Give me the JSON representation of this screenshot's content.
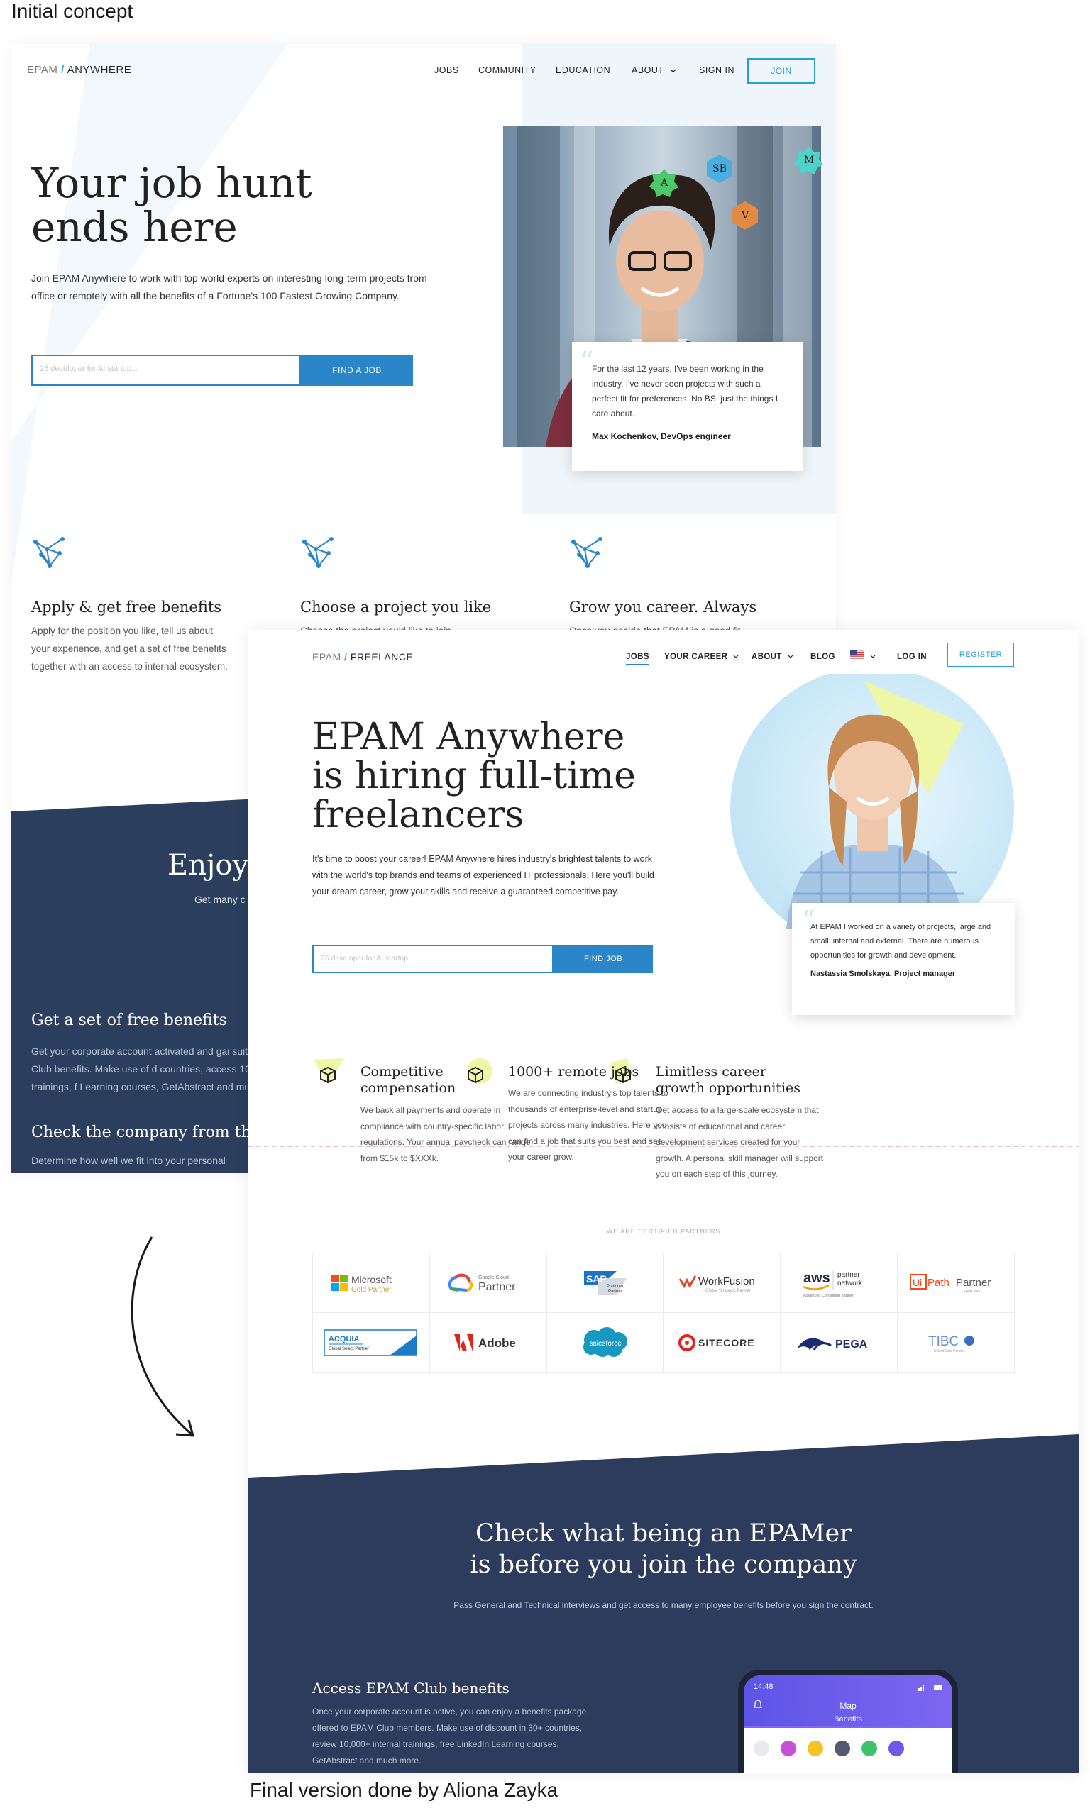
{
  "captions": {
    "top": "Initial concept",
    "bottom": "Final version done by Aliona Zayka"
  },
  "concept": {
    "logo": {
      "brand": "EPAM",
      "sep": "/",
      "product": "ANYWHERE"
    },
    "nav": [
      "JOBS",
      "COMMUNITY",
      "EDUCATION",
      "ABOUT",
      "SIGN IN"
    ],
    "join_label": "JOIN",
    "title_line1": "Your job hunt",
    "title_line2": "ends here",
    "lead": "Join EPAM Anywhere to work with top world experts on interesting long-term projects from office or remotely with all the  benefits of a Fortune's 100 Fastest Growing Company.",
    "search_placeholder": "25 developer for AI startup...",
    "find_label": "FIND A JOB",
    "badges": [
      "A",
      "SB",
      "V",
      "M"
    ],
    "quote_text": "For the last 12 years, I've been working in the industry, I've never seen projects with such a perfect fit for preferences. No BS, just the things I care about.",
    "quote_author": "Max Kochenkov, DevOps engineer",
    "features": [
      {
        "title": "Apply & get free benefits",
        "text": "Apply for the position you like, tell us about your experience, and get a set of free benefits together with an access to internal ecosystem."
      },
      {
        "title": "Choose a project you like",
        "text": "Choose the project you'd like to join -"
      },
      {
        "title": "Grow you career. Always",
        "text": "Once you decide that EPAM is a good fit"
      }
    ],
    "enjoy": "Enjoy",
    "get_many": "Get many c",
    "free_title": "Get a set of free benefits",
    "free_text": "Get your corporate account activated and gai suit of free EPAM Club benefits. Make use of d countries, access 10,000+ internal trainings, f Learning courses, GetAbstract and much mor",
    "check_title": "Check the company from the",
    "check_text": "Determine how well we fit into your personal"
  },
  "final": {
    "logo": {
      "brand": "EPAM",
      "sep": "/",
      "product": "FREELANCE"
    },
    "nav": [
      "JOBS",
      "YOUR CAREER",
      "ABOUT",
      "BLOG",
      "LOG IN"
    ],
    "register_label": "REGISTER",
    "title_line1": "EPAM Anywhere",
    "title_line2": "is hiring full-time",
    "title_line3": "freelancers",
    "lead": "It's time to boost your career! EPAM Anywhere hires industry's brightest talents to work with the world's top brands and teams of experienced IT professionals. Here you'll build your dream career, grow your skills and receive a guaranteed competitive  pay.",
    "search_placeholder": "25 developer for AI startup...",
    "find_label": "FIND JOB",
    "quote_text": "At EPAM I worked on a variety of projects, large and small, internal and external. There are numerous opportunities for growth and development.",
    "quote_author": "Nastassia Smolskaya, Project manager",
    "features": [
      {
        "title": "Competitive compensation",
        "text": "We back all payments and operate in compliance with country-specific labor regulations. Your annual paycheck can range from $15k to $XXXk."
      },
      {
        "title": "1000+ remote jobs",
        "text": "We are connecting industry's top talents to thousands of enterprise-level and startup projects across many industries. Here you can find a job that suits you best and see your career grow."
      },
      {
        "title": "Limitless career growth opportunities",
        "text": "Get access to a large-scale ecosystem that consists of educational and career development services created for your growth. A personal skill manager will support you on each step of this journey."
      }
    ],
    "partners_label": "WE ARE CERTIFIED PARTNERS",
    "partners": {
      "microsoft": [
        "Microsoft",
        "Gold Partner"
      ],
      "google": [
        "Google Cloud",
        "Partner"
      ],
      "sap": [
        "SAP",
        "Platinum",
        "Partner"
      ],
      "workfusion": [
        "WorkFusion",
        "Global Strategic Partner"
      ],
      "aws": [
        "aws",
        "partner",
        "network",
        "Advanced Consulting partner"
      ],
      "uipath": [
        "Ui",
        "Path",
        "Partner",
        "DIAMOND"
      ],
      "acquia": [
        "ACQUIA",
        "Global Select Partner"
      ],
      "adobe": "Adobe",
      "salesforce": "salesforce",
      "sitecore": "SITECORE",
      "pega": "PEGA",
      "tibco": [
        "TIBC",
        "Select Gold Partner"
      ]
    },
    "check_line1": "Check what being an EPAMer",
    "check_line2": "is before you join the company",
    "pass_text": "Pass General and Technical interviews and get access to many employee benefits before you sign the contract.",
    "club_title": "Access EPAM Club benefits",
    "club_text": "Once your corporate account is active, you can enjoy a benefits package offered to EPAM Club members. Make use of discount in 30+ countries, review 10,000+ internal trainings, free LinkedIn Learning courses, GetAbstract and much more.",
    "phone": {
      "time": "14:48",
      "tab_map": "Map",
      "tab_benefits": "Benefits"
    }
  },
  "colors": {
    "accent": "#2a86c9",
    "navy": "#2d3c5c",
    "hero_light": "#eef6fb",
    "lime": "#eef7a6"
  },
  "icons": [
    "network-icon",
    "box-icon",
    "chevron-down-icon",
    "us-flag-icon",
    "quote-icon",
    "curved-arrow-icon"
  ]
}
